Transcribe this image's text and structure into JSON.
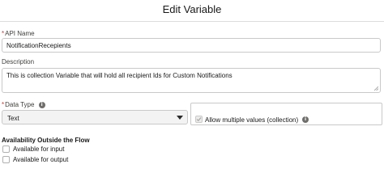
{
  "header": {
    "title": "Edit Variable"
  },
  "api_name": {
    "required_marker": "*",
    "label": "API Name",
    "value": "NotificationRecepients"
  },
  "description": {
    "label": "Description",
    "value": "This is collection Variable that will hold all recipient Ids for Custom Notifications"
  },
  "data_type": {
    "required_marker": "*",
    "label": "Data Type",
    "selected": "Text",
    "info_icon": "info-icon"
  },
  "collection": {
    "label": "Allow multiple values (collection)",
    "checked": true,
    "disabled": true,
    "info_icon": "info-icon"
  },
  "availability": {
    "title": "Availability Outside the Flow",
    "options": [
      {
        "label": "Available for input",
        "checked": false
      },
      {
        "label": "Available for output",
        "checked": false
      }
    ]
  },
  "colors": {
    "required": "#c23934",
    "border": "#c9c9c9",
    "select_bg": "#f3f3f3",
    "text": "#181818"
  }
}
